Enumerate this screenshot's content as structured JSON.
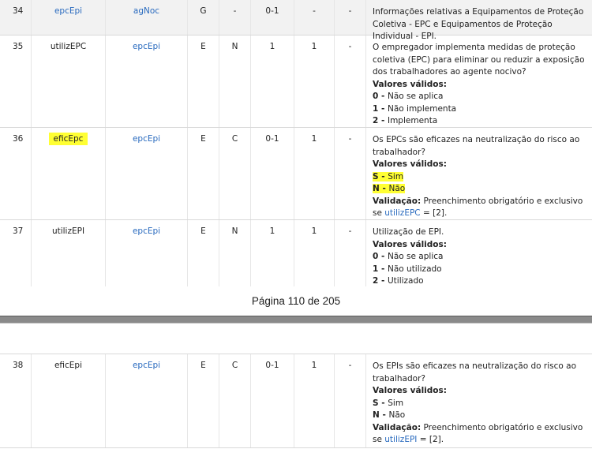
{
  "rows_top": [
    {
      "num": "34",
      "campo": "epcEpi",
      "pai": "agNoc",
      "ele": "G",
      "tipo": "-",
      "ocorr": "0-1",
      "tam": "-",
      "dec": "-",
      "desc": "Informações relativas a Equipamentos de Proteção Coletiva - EPC e Equipamentos de Proteção Individual - EPI."
    },
    {
      "num": "35",
      "campo": "utilizEPC",
      "pai": "epcEpi",
      "ele": "E",
      "tipo": "N",
      "ocorr": "1",
      "tam": "1",
      "dec": "-",
      "desc": "O empregador implementa medidas de proteção coletiva (EPC) para eliminar ou reduzir a exposição dos trabalhadores ao agente nocivo?",
      "vv_label": "Valores válidos:",
      "opts": [
        {
          "k": "0",
          "v": "Não se aplica"
        },
        {
          "k": "1",
          "v": "Não implementa"
        },
        {
          "k": "2",
          "v": "Implementa"
        }
      ]
    },
    {
      "num": "36",
      "campo": "eficEpc",
      "pai": "epcEpi",
      "ele": "E",
      "tipo": "C",
      "ocorr": "0-1",
      "tam": "1",
      "dec": "-",
      "desc": "Os EPCs são eficazes na neutralização do risco ao trabalhador?",
      "vv_label": "Valores válidos:",
      "opts": [
        {
          "k": "S",
          "v": "Sim"
        },
        {
          "k": "N",
          "v": "Não"
        }
      ],
      "val_label": "Validação:",
      "val_text": "Preenchimento obrigatório e exclusivo se",
      "val_link": "utilizEPC",
      "val_end": "= [2]."
    },
    {
      "num": "37",
      "campo": "utilizEPI",
      "pai": "epcEpi",
      "ele": "E",
      "tipo": "N",
      "ocorr": "1",
      "tam": "1",
      "dec": "-",
      "desc": "Utilização de EPI.",
      "vv_label": "Valores válidos:",
      "opts": [
        {
          "k": "0",
          "v": "Não se aplica"
        },
        {
          "k": "1",
          "v": "Não utilizado"
        },
        {
          "k": "2",
          "v": "Utilizado"
        }
      ]
    }
  ],
  "footer": "Página 110 de 205",
  "row_bottom": {
    "num": "38",
    "campo": "eficEpi",
    "pai": "epcEpi",
    "ele": "E",
    "tipo": "C",
    "ocorr": "0-1",
    "tam": "1",
    "dec": "-",
    "desc": "Os EPIs são eficazes na neutralização do risco ao trabalhador?",
    "vv_label": "Valores válidos:",
    "opts": [
      {
        "k": "S",
        "v": "Sim"
      },
      {
        "k": "N",
        "v": "Não"
      }
    ],
    "val_label": "Validação:",
    "val_text": "Preenchimento obrigatório e exclusivo se",
    "val_link": "utilizEPI",
    "val_end": "= [2]."
  }
}
